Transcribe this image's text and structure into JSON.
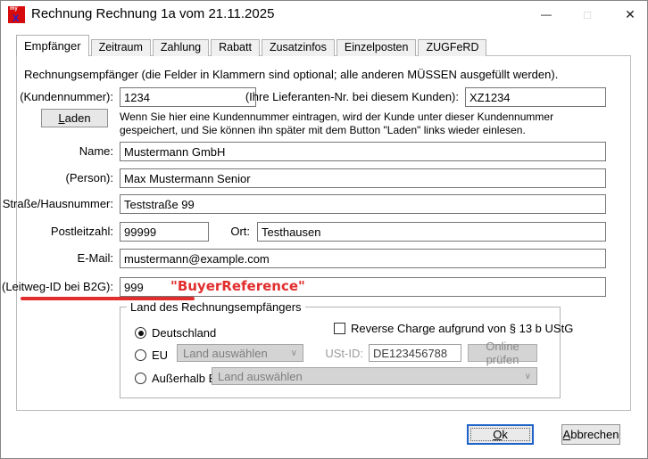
{
  "window": {
    "title": "Rechnung Rechnung 1a vom 21.11.2025",
    "icon": {
      "line1": "my",
      "line2": "X"
    },
    "controls": {
      "minimize": "—",
      "maximize": "□",
      "close": "✕"
    }
  },
  "tabs": [
    {
      "label": "Empfänger"
    },
    {
      "label": "Zeitraum"
    },
    {
      "label": "Zahlung"
    },
    {
      "label": "Rabatt"
    },
    {
      "label": "Zusatzinfos"
    },
    {
      "label": "Einzelposten"
    },
    {
      "label": "ZUGFeRD"
    }
  ],
  "form": {
    "intro": "Rechnungsempfänger (die Felder in Klammern sind optional; alle anderen MÜSSEN ausgefüllt werden).",
    "kundennummer": {
      "label": "(Kundennummer):",
      "value": "1234"
    },
    "lieferanten_nr": {
      "label": "(Ihre Lieferanten-Nr. bei diesem Kunden):",
      "value": "XZ1234"
    },
    "laden": {
      "mn": "L",
      "rest": "aden"
    },
    "laden_hint_line1": "Wenn Sie hier eine Kundennummer eintragen, wird der Kunde unter dieser Kundennummer",
    "laden_hint_line2": "gespeichert, und Sie können ihn später mit dem Button \"Laden\" links wieder einlesen.",
    "name": {
      "label": "Name:",
      "value": "Mustermann GmbH"
    },
    "person": {
      "label": "(Person):",
      "value": "Max Mustermann Senior"
    },
    "strasse": {
      "label": "Straße/Hausnummer:",
      "value": "Teststraße 99"
    },
    "plz": {
      "label": "Postleitzahl:",
      "value": "99999"
    },
    "ort": {
      "label": "Ort:",
      "value": "Testhausen"
    },
    "email": {
      "label": "E-Mail:",
      "value": "mustermann@example.com"
    },
    "leitweg": {
      "label": "(Leitweg-ID bei B2G):",
      "value": "999"
    },
    "annotation": {
      "text": "\"BuyerReference\"",
      "color": "#e22d2d"
    }
  },
  "country_group": {
    "legend": "Land des Rechnungsempfängers",
    "deutschland": {
      "label": "Deutschland",
      "selected": true
    },
    "reverse_charge": {
      "label": "Reverse Charge aufgrund von § 13 b UStG",
      "checked": false
    },
    "eu": {
      "label": "EU",
      "selected": false,
      "select_value": "Land auswählen"
    },
    "ustid": {
      "label": "USt-ID:",
      "value": "DE123456788"
    },
    "online_pruefen": {
      "label": "Online prüfen"
    },
    "ausserhalb_eu": {
      "label": "Außerhalb EU",
      "selected": false,
      "select_value": "Land auswählen"
    },
    "chevron": "∨"
  },
  "footer": {
    "ok": {
      "mn": "O",
      "rest": "k"
    },
    "cancel": {
      "mn": "A",
      "rest": "bbrechen"
    }
  }
}
